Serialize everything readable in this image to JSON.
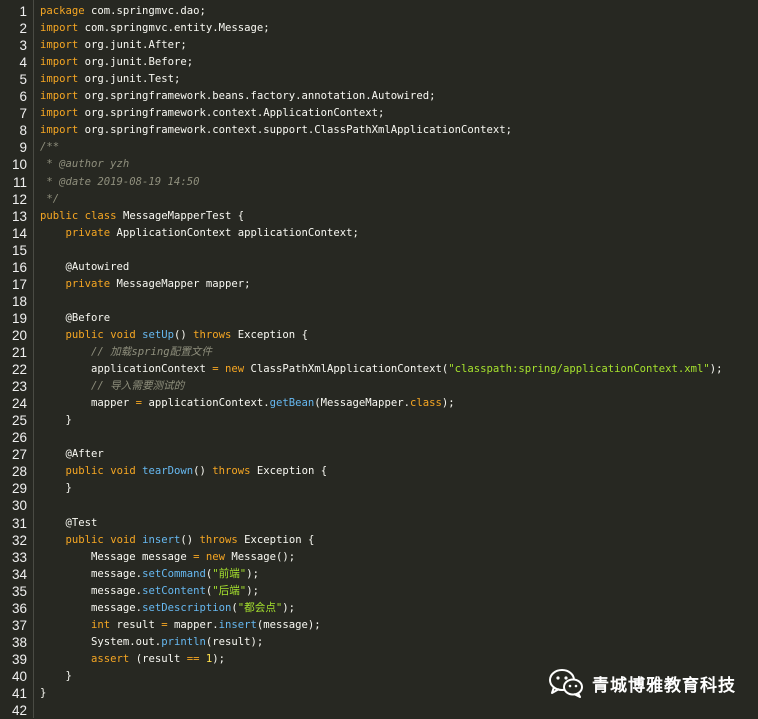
{
  "colors": {
    "background": "#272822",
    "gutter_text": "#f0f0f0",
    "plain": "#f8f8f2",
    "keyword": "#f5a623",
    "type": "#e8e8e8",
    "function": "#66b8f0",
    "string": "#a6e22e",
    "comment": "#8f8f7d",
    "annotation": "#f8f8f2",
    "number": "#ffe14d"
  },
  "code_lines": [
    {
      "n": "1",
      "parts": [
        {
          "t": "package",
          "c": "keyword"
        },
        {
          "t": " com.springmvc.dao;",
          "c": "plain"
        }
      ]
    },
    {
      "n": "2",
      "parts": [
        {
          "t": "import",
          "c": "keyword"
        },
        {
          "t": " com.springmvc.entity.Message;",
          "c": "plain"
        }
      ]
    },
    {
      "n": "3",
      "parts": [
        {
          "t": "import",
          "c": "keyword"
        },
        {
          "t": " org.junit.After;",
          "c": "plain"
        }
      ]
    },
    {
      "n": "4",
      "parts": [
        {
          "t": "import",
          "c": "keyword"
        },
        {
          "t": " org.junit.Before;",
          "c": "plain"
        }
      ]
    },
    {
      "n": "5",
      "parts": [
        {
          "t": "import",
          "c": "keyword"
        },
        {
          "t": " org.junit.Test;",
          "c": "plain"
        }
      ]
    },
    {
      "n": "6",
      "parts": [
        {
          "t": "import",
          "c": "keyword"
        },
        {
          "t": " org.springframework.beans.factory.annotation.Autowired;",
          "c": "plain"
        }
      ]
    },
    {
      "n": "7",
      "parts": [
        {
          "t": "import",
          "c": "keyword"
        },
        {
          "t": " org.springframework.context.ApplicationContext;",
          "c": "plain"
        }
      ]
    },
    {
      "n": "8",
      "parts": [
        {
          "t": "import",
          "c": "keyword"
        },
        {
          "t": " org.springframework.context.support.ClassPathXmlApplicationContext;",
          "c": "plain"
        }
      ]
    },
    {
      "n": "9",
      "parts": [
        {
          "t": "/**",
          "c": "comment"
        }
      ]
    },
    {
      "n": "10",
      "parts": [
        {
          "t": " * @author yzh",
          "c": "comment"
        }
      ]
    },
    {
      "n": "11",
      "parts": [
        {
          "t": " * @date 2019-08-19 14:50",
          "c": "comment"
        }
      ]
    },
    {
      "n": "12",
      "parts": [
        {
          "t": " */",
          "c": "comment"
        }
      ]
    },
    {
      "n": "13",
      "parts": [
        {
          "t": "public",
          "c": "keyword"
        },
        {
          "t": " ",
          "c": "plain"
        },
        {
          "t": "class",
          "c": "keyword"
        },
        {
          "t": " MessageMapperTest {",
          "c": "plain"
        }
      ]
    },
    {
      "n": "14",
      "parts": [
        {
          "t": "    ",
          "c": "plain"
        },
        {
          "t": "private",
          "c": "keyword"
        },
        {
          "t": " ApplicationContext applicationContext;",
          "c": "plain"
        }
      ]
    },
    {
      "n": "15",
      "parts": []
    },
    {
      "n": "16",
      "parts": [
        {
          "t": "    @Autowired",
          "c": "annotation"
        }
      ]
    },
    {
      "n": "17",
      "parts": [
        {
          "t": "    ",
          "c": "plain"
        },
        {
          "t": "private",
          "c": "keyword"
        },
        {
          "t": " MessageMapper mapper;",
          "c": "plain"
        }
      ]
    },
    {
      "n": "18",
      "parts": []
    },
    {
      "n": "19",
      "parts": [
        {
          "t": "    @Before",
          "c": "annotation"
        }
      ]
    },
    {
      "n": "20",
      "parts": [
        {
          "t": "    ",
          "c": "plain"
        },
        {
          "t": "public",
          "c": "keyword"
        },
        {
          "t": " ",
          "c": "plain"
        },
        {
          "t": "void",
          "c": "keyword"
        },
        {
          "t": " ",
          "c": "plain"
        },
        {
          "t": "setUp",
          "c": "function"
        },
        {
          "t": "() ",
          "c": "plain"
        },
        {
          "t": "throws",
          "c": "keyword"
        },
        {
          "t": " Exception {",
          "c": "plain"
        }
      ]
    },
    {
      "n": "21",
      "parts": [
        {
          "t": "        // 加载spring配置文件",
          "c": "comment"
        }
      ]
    },
    {
      "n": "22",
      "parts": [
        {
          "t": "        applicationContext ",
          "c": "plain"
        },
        {
          "t": "=",
          "c": "keyword"
        },
        {
          "t": " ",
          "c": "plain"
        },
        {
          "t": "new",
          "c": "keyword"
        },
        {
          "t": " ClassPathXmlApplicationContext(",
          "c": "plain"
        },
        {
          "t": "\"classpath:spring/applicationContext.xml\"",
          "c": "string"
        },
        {
          "t": ");",
          "c": "plain"
        }
      ]
    },
    {
      "n": "23",
      "parts": [
        {
          "t": "        // 导入需要测试的",
          "c": "comment"
        }
      ]
    },
    {
      "n": "24",
      "parts": [
        {
          "t": "        mapper ",
          "c": "plain"
        },
        {
          "t": "=",
          "c": "keyword"
        },
        {
          "t": " applicationContext.",
          "c": "plain"
        },
        {
          "t": "getBean",
          "c": "function"
        },
        {
          "t": "(MessageMapper.",
          "c": "plain"
        },
        {
          "t": "class",
          "c": "keyword"
        },
        {
          "t": ");",
          "c": "plain"
        }
      ]
    },
    {
      "n": "25",
      "parts": [
        {
          "t": "    }",
          "c": "plain"
        }
      ]
    },
    {
      "n": "26",
      "parts": []
    },
    {
      "n": "27",
      "parts": [
        {
          "t": "    @After",
          "c": "annotation"
        }
      ]
    },
    {
      "n": "28",
      "parts": [
        {
          "t": "    ",
          "c": "plain"
        },
        {
          "t": "public",
          "c": "keyword"
        },
        {
          "t": " ",
          "c": "plain"
        },
        {
          "t": "void",
          "c": "keyword"
        },
        {
          "t": " ",
          "c": "plain"
        },
        {
          "t": "tearDown",
          "c": "function"
        },
        {
          "t": "() ",
          "c": "plain"
        },
        {
          "t": "throws",
          "c": "keyword"
        },
        {
          "t": " Exception {",
          "c": "plain"
        }
      ]
    },
    {
      "n": "29",
      "parts": [
        {
          "t": "    }",
          "c": "plain"
        }
      ]
    },
    {
      "n": "30",
      "parts": []
    },
    {
      "n": "31",
      "parts": [
        {
          "t": "    @Test",
          "c": "annotation"
        }
      ]
    },
    {
      "n": "32",
      "parts": [
        {
          "t": "    ",
          "c": "plain"
        },
        {
          "t": "public",
          "c": "keyword"
        },
        {
          "t": " ",
          "c": "plain"
        },
        {
          "t": "void",
          "c": "keyword"
        },
        {
          "t": " ",
          "c": "plain"
        },
        {
          "t": "insert",
          "c": "function"
        },
        {
          "t": "() ",
          "c": "plain"
        },
        {
          "t": "throws",
          "c": "keyword"
        },
        {
          "t": " Exception {",
          "c": "plain"
        }
      ]
    },
    {
      "n": "33",
      "parts": [
        {
          "t": "        Message message ",
          "c": "plain"
        },
        {
          "t": "=",
          "c": "keyword"
        },
        {
          "t": " ",
          "c": "plain"
        },
        {
          "t": "new",
          "c": "keyword"
        },
        {
          "t": " Message();",
          "c": "plain"
        }
      ]
    },
    {
      "n": "34",
      "parts": [
        {
          "t": "        message.",
          "c": "plain"
        },
        {
          "t": "setCommand",
          "c": "function"
        },
        {
          "t": "(",
          "c": "plain"
        },
        {
          "t": "\"前端\"",
          "c": "string"
        },
        {
          "t": ");",
          "c": "plain"
        }
      ]
    },
    {
      "n": "35",
      "parts": [
        {
          "t": "        message.",
          "c": "plain"
        },
        {
          "t": "setContent",
          "c": "function"
        },
        {
          "t": "(",
          "c": "plain"
        },
        {
          "t": "\"后端\"",
          "c": "string"
        },
        {
          "t": ");",
          "c": "plain"
        }
      ]
    },
    {
      "n": "36",
      "parts": [
        {
          "t": "        message.",
          "c": "plain"
        },
        {
          "t": "setDescription",
          "c": "function"
        },
        {
          "t": "(",
          "c": "plain"
        },
        {
          "t": "\"都会点\"",
          "c": "string"
        },
        {
          "t": ");",
          "c": "plain"
        }
      ]
    },
    {
      "n": "37",
      "parts": [
        {
          "t": "        ",
          "c": "plain"
        },
        {
          "t": "int",
          "c": "keyword"
        },
        {
          "t": " result ",
          "c": "plain"
        },
        {
          "t": "=",
          "c": "keyword"
        },
        {
          "t": " mapper.",
          "c": "plain"
        },
        {
          "t": "insert",
          "c": "function"
        },
        {
          "t": "(message);",
          "c": "plain"
        }
      ]
    },
    {
      "n": "38",
      "parts": [
        {
          "t": "        System.out.",
          "c": "plain"
        },
        {
          "t": "println",
          "c": "function"
        },
        {
          "t": "(result);",
          "c": "plain"
        }
      ]
    },
    {
      "n": "39",
      "parts": [
        {
          "t": "        ",
          "c": "plain"
        },
        {
          "t": "assert",
          "c": "keyword"
        },
        {
          "t": " (result ",
          "c": "plain"
        },
        {
          "t": "==",
          "c": "keyword"
        },
        {
          "t": " ",
          "c": "plain"
        },
        {
          "t": "1",
          "c": "number"
        },
        {
          "t": ");",
          "c": "plain"
        }
      ]
    },
    {
      "n": "40",
      "parts": [
        {
          "t": "    }",
          "c": "plain"
        }
      ]
    },
    {
      "n": "41",
      "parts": [
        {
          "t": "}",
          "c": "plain"
        }
      ]
    },
    {
      "n": "42",
      "parts": []
    }
  ],
  "watermark": {
    "icon": "wechat-icon",
    "text": "青城博雅教育科技"
  }
}
